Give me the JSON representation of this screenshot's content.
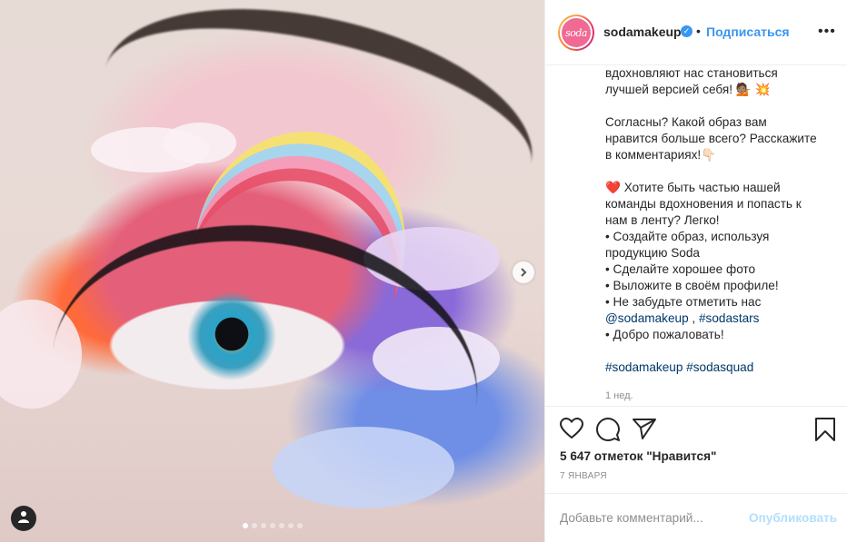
{
  "post": {
    "carousel": {
      "total": 7,
      "active_index": 0,
      "next_icon": "chevron-right-icon",
      "user_tag_icon": "user-icon"
    },
    "author": {
      "avatar_text": "soda",
      "username": "sodamakeup",
      "verified": true,
      "separator": "•",
      "follow_label": "Подписаться",
      "more_icon": "more-horizontal-icon",
      "more_label": "•••"
    },
    "caption": {
      "lines": [
        {
          "text": "вдохновляют нас становиться"
        },
        {
          "text": "лучшей версией себя! 💁🏽 💥"
        },
        {
          "gap": true
        },
        {
          "text": "Согласны? Какой образ вам"
        },
        {
          "text": "нравится больше всего? Расскажите"
        },
        {
          "text": "в комментариях!👇🏻"
        },
        {
          "gap": true
        },
        {
          "text": "❤️ Хотите быть частью нашей"
        },
        {
          "text": "команды вдохновения и попасть к"
        },
        {
          "text": "нам в ленту? Легко!"
        },
        {
          "text": "• Создайте образ, используя"
        },
        {
          "text": "продукцию Soda"
        },
        {
          "text": "• Сделайте хорошее фото"
        },
        {
          "text": "• Выложите в своём профиле!"
        },
        {
          "text": "• Не забудьте отметить нас"
        }
      ],
      "mention_line": {
        "mention1": "@sodamakeup",
        "sep": " , ",
        "mention2": "#sodastars"
      },
      "welcome": "• Добро пожаловать!",
      "hashtags": "#sodamakeup #sodasquad",
      "time_ago": "1 нед."
    },
    "actions": {
      "like_icon": "heart-icon",
      "comment_icon": "comment-icon",
      "share_icon": "paper-plane-icon",
      "save_icon": "bookmark-icon"
    },
    "likes_text": "5 647 отметок \"Нравится\"",
    "date_text": "7 ЯНВАРЯ",
    "comment": {
      "placeholder": "Добавьте комментарий...",
      "value": "",
      "post_label": "Опубликовать"
    }
  },
  "colors": {
    "accent_blue": "#3897f0",
    "link": "#00376b",
    "muted": "#8e8e8e",
    "post_disabled": "#b2dffc",
    "avatar_pink": "#f06a93"
  }
}
